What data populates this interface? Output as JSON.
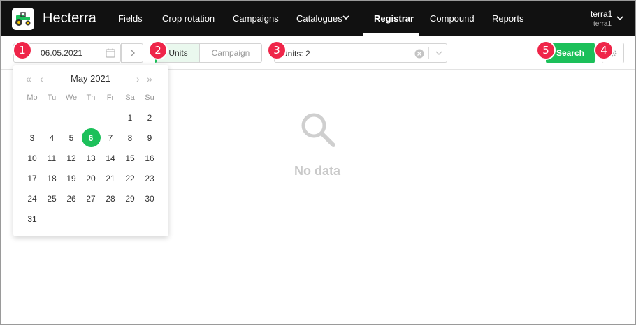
{
  "app": {
    "title": "Hecterra"
  },
  "nav": {
    "items": [
      {
        "label": "Fields"
      },
      {
        "label": "Crop rotation"
      },
      {
        "label": "Campaigns"
      },
      {
        "label": "Catalogues"
      },
      {
        "label": "Registrar"
      },
      {
        "label": "Compound"
      },
      {
        "label": "Reports"
      }
    ],
    "active": "Registrar"
  },
  "user": {
    "name": "terra1",
    "login": "terra1"
  },
  "toolbar": {
    "date_value": "06.05.2021",
    "segment_units": "Units",
    "segment_campaign": "Campaign",
    "units_value": "Units: 2",
    "search_label": "Search"
  },
  "markers": [
    "1",
    "2",
    "3",
    "4",
    "5"
  ],
  "empty_state": {
    "text": "No data"
  },
  "calendar": {
    "month_label": "May 2021",
    "weekdays": [
      "Mo",
      "Tu",
      "We",
      "Th",
      "Fr",
      "Sa",
      "Su"
    ],
    "days": [
      "",
      "",
      "",
      "",
      "",
      "1",
      "2",
      "3",
      "4",
      "5",
      "6",
      "7",
      "8",
      "9",
      "10",
      "11",
      "12",
      "13",
      "14",
      "15",
      "16",
      "17",
      "18",
      "19",
      "20",
      "21",
      "22",
      "23",
      "24",
      "25",
      "26",
      "27",
      "28",
      "29",
      "30",
      "31"
    ],
    "selected_day": "6"
  },
  "colors": {
    "accent": "#1cc05a",
    "marker": "#ef2549",
    "navbar": "#111111"
  }
}
